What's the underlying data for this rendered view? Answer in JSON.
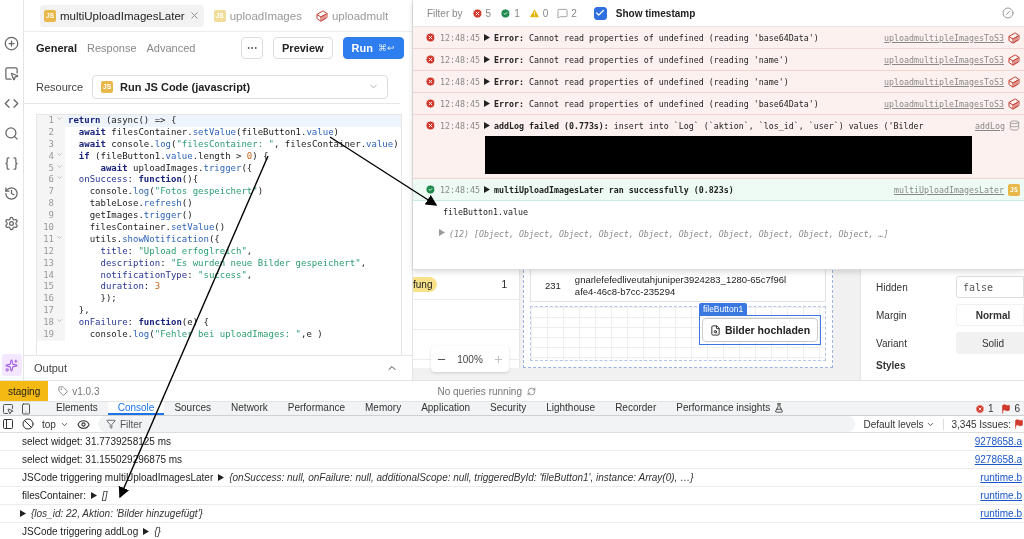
{
  "editor": {
    "tabs": [
      {
        "label": "multiUploadImagesLater",
        "selected": true,
        "kind": "js",
        "badge": "JS"
      },
      {
        "label": "uploadImages",
        "selected": false,
        "kind": "js",
        "badge": "JS"
      },
      {
        "label": "uploadmult",
        "selected": false,
        "kind": "s3"
      }
    ],
    "subtabs": [
      {
        "label": "General",
        "selected": true
      },
      {
        "label": "Response",
        "selected": false
      },
      {
        "label": "Advanced",
        "selected": false
      }
    ],
    "preview_button": "Preview",
    "run_button": {
      "label": "Run",
      "shortcut": "⌘↩"
    },
    "resource": {
      "label": "Resource",
      "badge": "JS",
      "value": "Run JS Code (javascript)"
    },
    "code": [
      {
        "n": "1",
        "fold": true,
        "tokens": [
          {
            "kind": "kw",
            "text": "return"
          },
          {
            "kind": "p",
            "text": " (async() => {"
          }
        ]
      },
      {
        "n": "2",
        "fold": false,
        "tokens": [
          {
            "kind": "kw",
            "text": "  await"
          },
          {
            "kind": "p",
            "text": " filesContainer."
          },
          {
            "kind": "fn",
            "text": "setValue"
          },
          {
            "kind": "p",
            "text": "(fileButton1."
          },
          {
            "kind": "fn",
            "text": "value"
          },
          {
            "kind": "p",
            "text": ")"
          }
        ]
      },
      {
        "n": "3",
        "fold": false,
        "tokens": [
          {
            "kind": "kw",
            "text": "  await"
          },
          {
            "kind": "p",
            "text": " console."
          },
          {
            "kind": "fn",
            "text": "log"
          },
          {
            "kind": "p",
            "text": "("
          },
          {
            "kind": "str",
            "text": "\"filesContainer: \""
          },
          {
            "kind": "p",
            "text": ", filesContainer."
          },
          {
            "kind": "fn",
            "text": "value"
          },
          {
            "kind": "p",
            "text": ")"
          }
        ]
      },
      {
        "n": "4",
        "fold": true,
        "tokens": [
          {
            "kind": "kw",
            "text": "  if"
          },
          {
            "kind": "p",
            "text": " (fileButton1."
          },
          {
            "kind": "fn",
            "text": "value"
          },
          {
            "kind": "p",
            "text": ".length > "
          },
          {
            "kind": "num",
            "text": "0"
          },
          {
            "kind": "p",
            "text": ") {"
          }
        ]
      },
      {
        "n": "5",
        "fold": true,
        "tokens": [
          {
            "kind": "kw",
            "text": "      await"
          },
          {
            "kind": "p",
            "text": " uploadImages."
          },
          {
            "kind": "fn",
            "text": "trigger"
          },
          {
            "kind": "p",
            "text": "({"
          }
        ]
      },
      {
        "n": "6",
        "fold": true,
        "tokens": [
          {
            "kind": "key",
            "text": "  onSuccess"
          },
          {
            "kind": "p",
            "text": ": "
          },
          {
            "kind": "kw",
            "text": "function"
          },
          {
            "kind": "p",
            "text": "(){"
          }
        ]
      },
      {
        "n": "7",
        "fold": false,
        "tokens": [
          {
            "kind": "p",
            "text": "    console."
          },
          {
            "kind": "fn",
            "text": "log"
          },
          {
            "kind": "p",
            "text": "("
          },
          {
            "kind": "str",
            "text": "\"Fotos gespeichert\""
          },
          {
            "kind": "p",
            "text": ")"
          }
        ]
      },
      {
        "n": "8",
        "fold": false,
        "tokens": [
          {
            "kind": "p",
            "text": "    tableLose."
          },
          {
            "kind": "fn",
            "text": "refresh"
          },
          {
            "kind": "p",
            "text": "()"
          }
        ]
      },
      {
        "n": "9",
        "fold": false,
        "tokens": [
          {
            "kind": "p",
            "text": "    getImages."
          },
          {
            "kind": "fn",
            "text": "trigger"
          },
          {
            "kind": "p",
            "text": "()"
          }
        ]
      },
      {
        "n": "10",
        "fold": false,
        "tokens": [
          {
            "kind": "p",
            "text": "    filesContainer."
          },
          {
            "kind": "fn",
            "text": "setValue"
          },
          {
            "kind": "p",
            "text": "()"
          }
        ]
      },
      {
        "n": "11",
        "fold": true,
        "tokens": [
          {
            "kind": "p",
            "text": "    utils."
          },
          {
            "kind": "fn",
            "text": "showNotification"
          },
          {
            "kind": "p",
            "text": "({"
          }
        ]
      },
      {
        "n": "12",
        "fold": false,
        "tokens": [
          {
            "kind": "key",
            "text": "      title"
          },
          {
            "kind": "p",
            "text": ": "
          },
          {
            "kind": "str",
            "text": "\"Upload erfoglreich\""
          },
          {
            "kind": "p",
            "text": ","
          }
        ]
      },
      {
        "n": "13",
        "fold": false,
        "tokens": [
          {
            "kind": "key",
            "text": "      description"
          },
          {
            "kind": "p",
            "text": ": "
          },
          {
            "kind": "str",
            "text": "\"Es wurden neue Bilder gespeichert\""
          },
          {
            "kind": "p",
            "text": ","
          }
        ]
      },
      {
        "n": "14",
        "fold": false,
        "tokens": [
          {
            "kind": "key",
            "text": "      notificationType"
          },
          {
            "kind": "p",
            "text": ": "
          },
          {
            "kind": "str",
            "text": "\"success\""
          },
          {
            "kind": "p",
            "text": ","
          }
        ]
      },
      {
        "n": "15",
        "fold": false,
        "tokens": [
          {
            "kind": "key",
            "text": "      duration"
          },
          {
            "kind": "p",
            "text": ": "
          },
          {
            "kind": "num",
            "text": "3"
          }
        ]
      },
      {
        "n": "16",
        "fold": false,
        "tokens": [
          {
            "kind": "p",
            "text": "      });"
          }
        ]
      },
      {
        "n": "17",
        "fold": false,
        "tokens": [
          {
            "kind": "p",
            "text": "  },"
          }
        ]
      },
      {
        "n": "18",
        "fold": true,
        "tokens": [
          {
            "kind": "key",
            "text": "  onFailure"
          },
          {
            "kind": "p",
            "text": ": "
          },
          {
            "kind": "kw",
            "text": "function"
          },
          {
            "kind": "p",
            "text": "(e) {"
          }
        ]
      },
      {
        "n": "19",
        "fold": false,
        "tokens": [
          {
            "kind": "p",
            "text": "    console."
          },
          {
            "kind": "fn",
            "text": "log"
          },
          {
            "kind": "p",
            "text": "("
          },
          {
            "kind": "str",
            "text": "\"Fehler bei uploadImages: \""
          },
          {
            "kind": "p",
            "text": ",e )"
          }
        ]
      }
    ],
    "output": "Output"
  },
  "debug": {
    "filter_label": "Filter by",
    "filters": [
      {
        "kind": "error",
        "count": "5"
      },
      {
        "kind": "success",
        "count": "1"
      },
      {
        "kind": "warning",
        "count": "0"
      },
      {
        "kind": "message",
        "count": "2"
      }
    ],
    "show_timestamp": {
      "label": "Show timestamp",
      "checked": true
    },
    "logs": [
      {
        "kind": "error",
        "time": "12:48:45",
        "text": "**Error:** Cannot read properties of undefined (reading 'base64Data')",
        "source": {
          "label": "uploadmultipleImagesToS3",
          "kind": "s3"
        },
        "redacted": false
      },
      {
        "kind": "error",
        "time": "12:48:45",
        "text": "**Error:** Cannot read properties of undefined (reading 'name')",
        "source": {
          "label": "uploadmultipleImagesToS3",
          "kind": "s3"
        },
        "redacted": false
      },
      {
        "kind": "error",
        "time": "12:48:45",
        "text": "**Error:** Cannot read properties of undefined (reading 'name')",
        "source": {
          "label": "uploadmultipleImagesToS3",
          "kind": "s3"
        },
        "redacted": false
      },
      {
        "kind": "error",
        "time": "12:48:45",
        "text": "**Error:** Cannot read properties of undefined (reading 'base64Data')",
        "source": {
          "label": "uploadmultipleImagesToS3",
          "kind": "s3"
        },
        "redacted": false
      },
      {
        "kind": "error",
        "time": "12:48:45",
        "text": "**addLog failed (0.773s):** insert into `Log` (`aktion`, `los_id`, `user`) values ('Bilder",
        "source": {
          "label": "addLog",
          "kind": "db"
        },
        "redacted": true
      },
      {
        "kind": "success",
        "time": "12:48:45",
        "text": "multiUploadImagesLater ran successfully (0.823s)",
        "source": {
          "label": "multiUploadImagesLater",
          "kind": "js",
          "badge": "JS"
        },
        "redacted": false
      }
    ],
    "expression": "fileButton1.value",
    "result": "(12) [Object, Object, Object, Object, Object, Object, Object, Object, Object, Object, …]"
  },
  "canvas": {
    "tag": "fung",
    "count": "1",
    "file_id": "231",
    "file_name": [
      "gnarlefefedliveutahjuniper3924283_1280-65c7f96l",
      "afe4-46c8-b7cc-235294"
    ],
    "widget_label": "fileButton1",
    "upload_button": "Bilder hochladen",
    "zoom": "100%"
  },
  "inspector": {
    "rows": [
      {
        "label": "Hidden",
        "value": "false",
        "kind": "input"
      },
      {
        "label": "Margin",
        "value": "Normal",
        "kind": "segment"
      },
      {
        "label": "Variant",
        "value": "Solid",
        "kind": "select"
      }
    ],
    "section": "Styles"
  },
  "status_bar": {
    "env": "staging",
    "version": "v1.0.3",
    "queries": "No queries running"
  },
  "devtools": {
    "tabs": [
      {
        "label": "Elements",
        "selected": false
      },
      {
        "label": "Console",
        "selected": true
      },
      {
        "label": "Sources",
        "selected": false
      },
      {
        "label": "Network",
        "selected": false
      },
      {
        "label": "Performance",
        "selected": false
      },
      {
        "label": "Memory",
        "selected": false
      },
      {
        "label": "Application",
        "selected": false
      },
      {
        "label": "Security",
        "selected": false
      },
      {
        "label": "Lighthouse",
        "selected": false
      },
      {
        "label": "Recorder",
        "selected": false
      },
      {
        "label": "Performance insights",
        "selected": false,
        "experimental": true
      }
    ],
    "error_count": "1",
    "issue_count": "6",
    "context": "top",
    "filter_placeholder": "Filter",
    "levels": "Default levels",
    "issues": "3,345 Issues:",
    "rows": [
      {
        "text": "select widget: 31.7739258125 ms",
        "source": "9278658.a"
      },
      {
        "text": "select widget: 31.155029296875 ms",
        "source": "9278658.a"
      },
      {
        "text": "JSCode triggering multiUploadImagesLater",
        "object": "{onSuccess: null, onFailure: null, additionalScope: null, triggeredById: 'fileButton1', instance: Array(0), …}",
        "source": "runtime.b"
      },
      {
        "text": "filesContainer:",
        "object": "[]",
        "source": "runtime.b"
      },
      {
        "object": "{los_id: 22, Aktion: 'Bilder hinzugefügt'}",
        "source": "runtime.b"
      },
      {
        "text": "JSCode triggering addLog",
        "object": "{}"
      }
    ]
  }
}
